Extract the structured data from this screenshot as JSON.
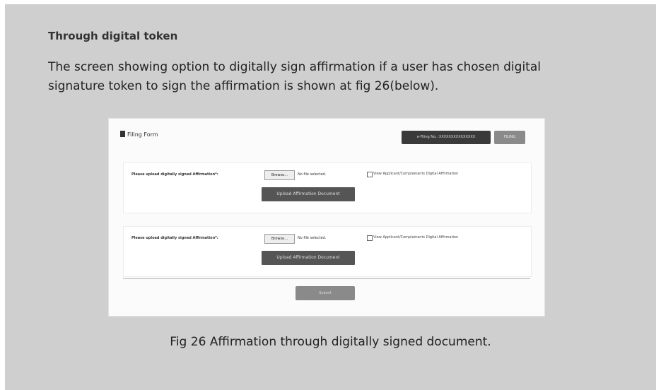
{
  "heading": "Through digital token",
  "paragraph_lines": [
    "The screen showing option to digitally sign affirmation if a user has chosen digital",
    "signature token to sign the affirmation is shown at fig 26(below)."
  ],
  "screenshot": {
    "form_title": "Filing Form",
    "filing_number": "e-Filing No.: XXXXXXXXXXXXXXX",
    "filing_button": "FILING",
    "sections": [
      {
        "label": "Please upload digitally signed Affirmation*:",
        "browse": "Browse...",
        "no_file": "No file selected.",
        "view_label": "View Applicant/Complainants Digital Affirmation",
        "upload": "Upload Affirmation Document"
      },
      {
        "label": "Please upload digitally signed Affirmation*:",
        "browse": "Browse...",
        "no_file": "No file selected.",
        "view_label": "View Applicant/Complainants Digital Affirmation",
        "upload": "Upload Affirmation Document"
      }
    ],
    "submit": "Submit"
  },
  "caption": "Fig 26 Affirmation through digitally signed document."
}
